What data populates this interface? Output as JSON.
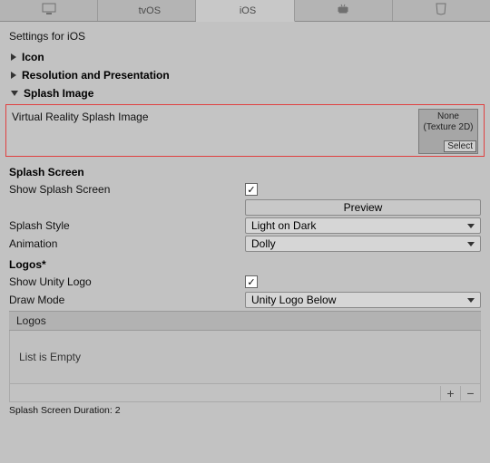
{
  "tabs": {
    "standalone_icon": "standalone-icon",
    "tvos_label": "tvOS",
    "ios_label": "iOS",
    "android_icon": "android-icon",
    "html5_icon": "html5-icon"
  },
  "title": "Settings for iOS",
  "foldouts": {
    "icon": "Icon",
    "resolution": "Resolution and Presentation",
    "splash": "Splash Image"
  },
  "splash_image": {
    "vr_label": "Virtual Reality Splash Image",
    "slot_line1": "None",
    "slot_line2": "(Texture 2D)",
    "select_label": "Select"
  },
  "splash_screen_header": "Splash Screen",
  "show_splash_label": "Show Splash Screen",
  "preview_button": "Preview",
  "splash_style_label": "Splash Style",
  "splash_style_value": "Light on Dark",
  "animation_label": "Animation",
  "animation_value": "Dolly",
  "logos_header": "Logos*",
  "show_unity_logo_label": "Show Unity Logo",
  "draw_mode_label": "Draw Mode",
  "draw_mode_value": "Unity Logo Below",
  "logos_bar": "Logos",
  "list_empty": "List is Empty",
  "duration_label": "Splash Screen Duration: 2",
  "plus": "+",
  "minus": "−",
  "check": "✓"
}
